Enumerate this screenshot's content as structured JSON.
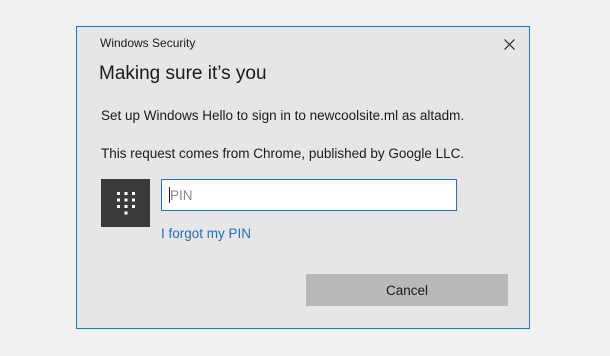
{
  "window": {
    "title": "Windows Security"
  },
  "dialog": {
    "heading": "Making sure it’s you",
    "message_setup": "Set up Windows Hello to sign in to newcoolsite.ml as altadm.",
    "message_source": "This request comes from Chrome, published by Google LLC."
  },
  "pin": {
    "icon": "keypad-icon",
    "placeholder": "PIN",
    "value": "",
    "forgot_link": "I forgot my PIN"
  },
  "actions": {
    "cancel_label": "Cancel"
  },
  "colors": {
    "dialog_border": "#1979ca",
    "dialog_background": "#e6e6e6",
    "link": "#1f6fc0",
    "input_border": "#2a72c0",
    "button_background": "#b9b9b9",
    "tile_background": "#3a3a3a"
  }
}
